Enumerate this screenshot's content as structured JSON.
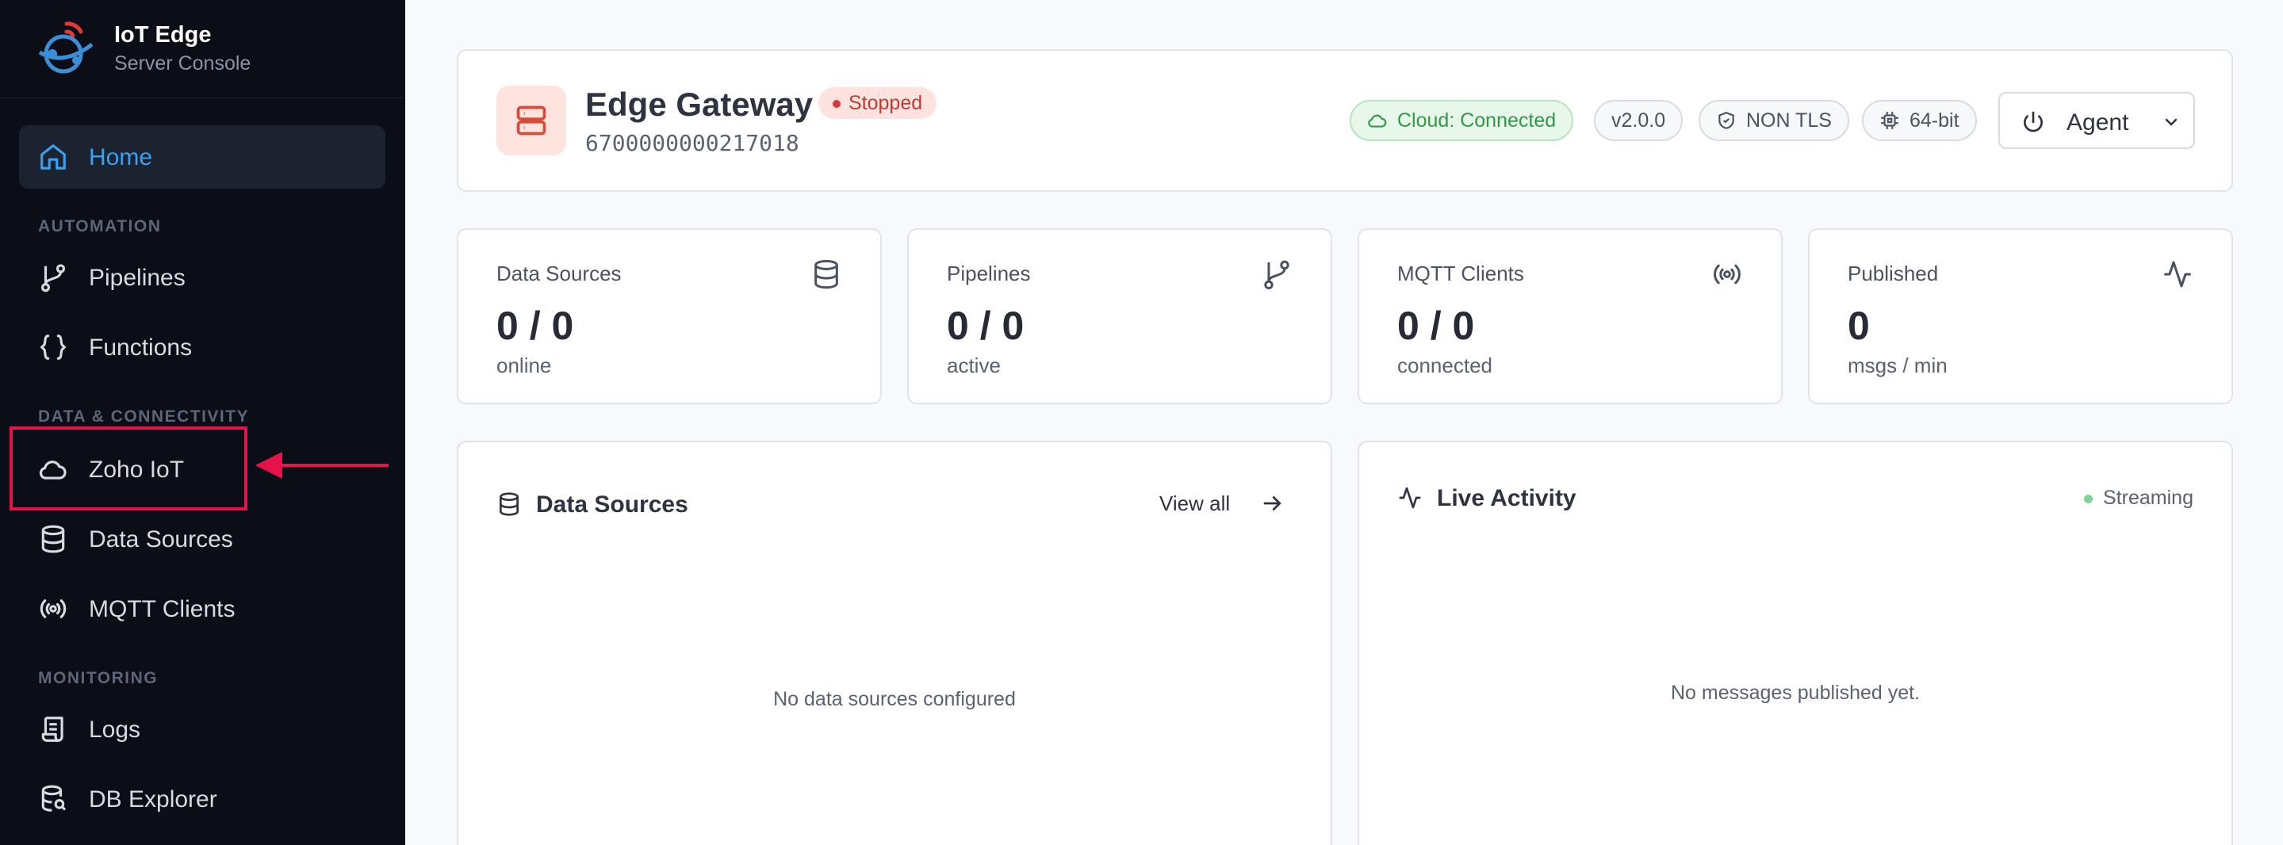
{
  "brand": {
    "title": "IoT Edge",
    "subtitle": "Server Console"
  },
  "nav": {
    "home": "Home",
    "sections": {
      "automation": "AUTOMATION",
      "data": "DATA & CONNECTIVITY",
      "monitoring": "MONITORING"
    },
    "items": {
      "pipelines": "Pipelines",
      "functions": "Functions",
      "zoho": "Zoho IoT",
      "data_sources": "Data Sources",
      "mqtt": "MQTT Clients",
      "logs": "Logs",
      "db": "DB Explorer"
    }
  },
  "gateway": {
    "title": "Edge Gateway",
    "status": "Stopped",
    "id": "6700000000217018",
    "cloud": "Cloud: Connected",
    "version": "v2.0.0",
    "tls": "NON TLS",
    "arch": "64-bit",
    "agent_label": "Agent"
  },
  "stats": [
    {
      "title": "Data Sources",
      "value": "0 / 0",
      "sub": "online",
      "icon": "database-icon"
    },
    {
      "title": "Pipelines",
      "value": "0 / 0",
      "sub": "active",
      "icon": "git-branch-icon"
    },
    {
      "title": "MQTT Clients",
      "value": "0 / 0",
      "sub": "connected",
      "icon": "broadcast-icon"
    },
    {
      "title": "Published",
      "value": "0",
      "sub": "msgs / min",
      "icon": "activity-icon"
    }
  ],
  "panels": {
    "data_sources": {
      "title": "Data Sources",
      "view_all": "View all",
      "empty": "No data sources configured"
    },
    "live": {
      "title": "Live Activity",
      "status": "Streaming",
      "empty": "No messages published yet."
    }
  },
  "colors": {
    "accent": "#3aa0f0",
    "highlight": "#e8124b",
    "sidebar_bg": "#0b0e16",
    "stopped": "#d63a32",
    "connected": "#2f9a4a"
  }
}
